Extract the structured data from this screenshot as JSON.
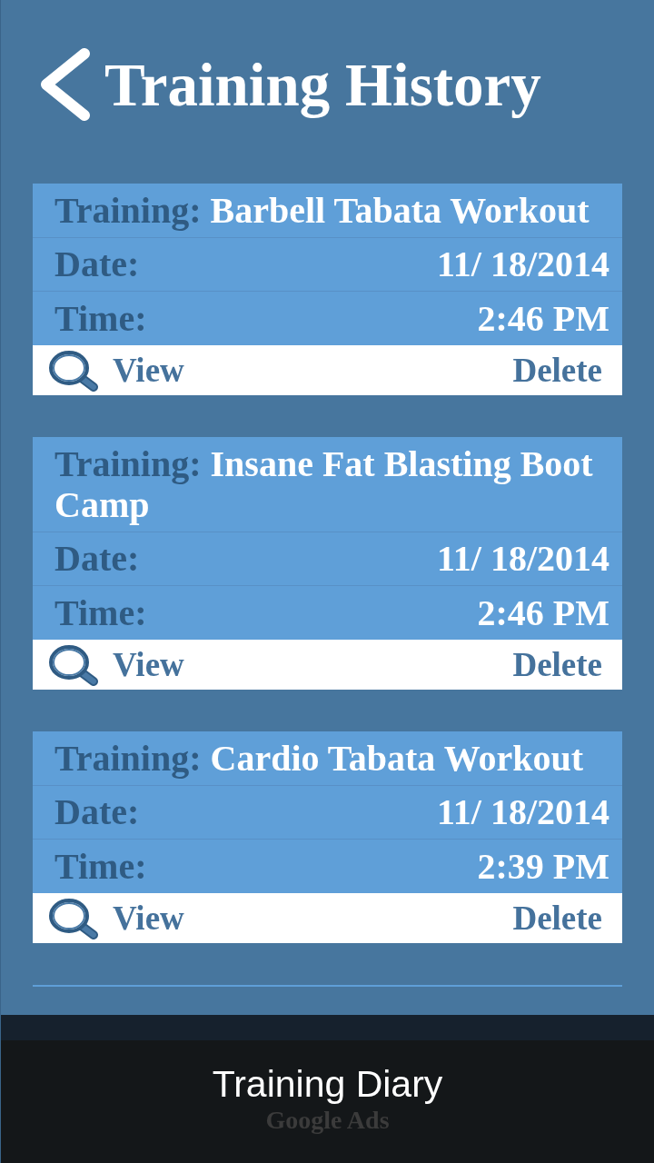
{
  "header": {
    "title": "Training History"
  },
  "trainings": [
    {
      "training_label": "Training:",
      "training": "Barbell Tabata Workout",
      "date_label": "Date:",
      "date": "11/ 18/2014",
      "time_label": "Time:",
      "time": "2:46 PM",
      "view": "View",
      "delete": "Delete"
    },
    {
      "training_label": "Training:",
      "training": "Insane Fat Blasting Boot Camp",
      "date_label": "Date:",
      "date": "11/ 18/2014",
      "time_label": "Time:",
      "time": "2:46 PM",
      "view": "View",
      "delete": "Delete"
    },
    {
      "training_label": "Training:",
      "training": "Cardio Tabata Workout",
      "date_label": "Date:",
      "date": "11/ 18/2014",
      "time_label": "Time:",
      "time": "2:39 PM",
      "view": "View",
      "delete": "Delete"
    }
  ],
  "ad_banner": {
    "label": "Google Ads"
  },
  "toast": {
    "text": "Training Diary"
  }
}
